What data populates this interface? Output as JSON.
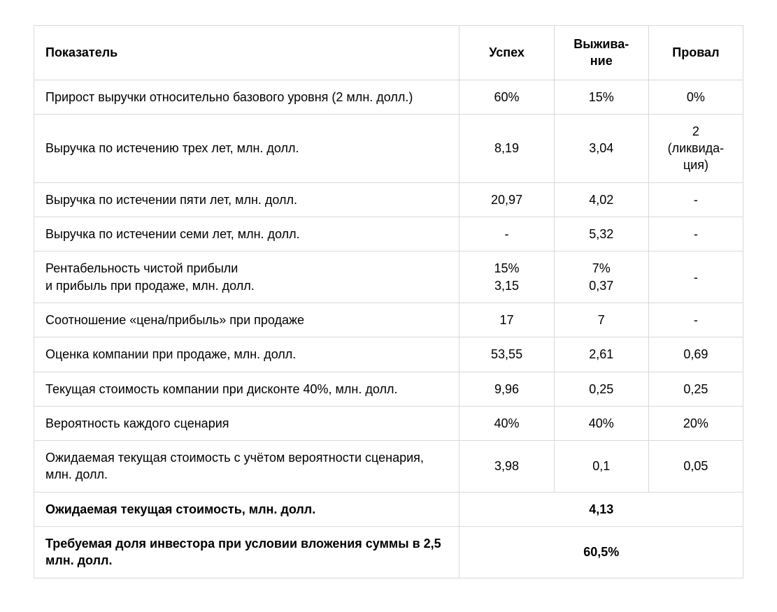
{
  "table": {
    "headers": {
      "indicator": "Показатель",
      "success": "Успех",
      "survival": "Выжива-\nние",
      "failure": "Провал"
    },
    "rows": [
      {
        "label": "Прирост выручки относительно базового уровня (2 млн. долл.)",
        "success": "60%",
        "survival": "15%",
        "failure": "0%"
      },
      {
        "label": "Выручка по истечению трех лет, млн. долл.",
        "success": "8,19",
        "survival": "3,04",
        "failure": "2\n(ликвида-\nция)"
      },
      {
        "label": "Выручка по истечении пяти лет, млн. долл.",
        "success": "20,97",
        "survival": "4,02",
        "failure": "-"
      },
      {
        "label": "Выручка по истечении семи лет, млн. долл.",
        "success": "-",
        "survival": "5,32",
        "failure": "-"
      },
      {
        "label": "Рентабельность чистой прибыли\nи прибыль при продаже, млн. долл.",
        "success": "15%\n3,15",
        "survival": "7%\n0,37",
        "failure": "-"
      },
      {
        "label": "Соотношение «цена/прибыль» при продаже",
        "success": "17",
        "survival": "7",
        "failure": "-"
      },
      {
        "label": "Оценка компании при продаже, млн. долл.",
        "success": "53,55",
        "survival": "2,61",
        "failure": "0,69"
      },
      {
        "label": "Текущая стоимость компании при дисконте 40%, млн. долл.",
        "success": "9,96",
        "survival": "0,25",
        "failure": "0,25"
      },
      {
        "label": "Вероятность каждого сценария",
        "success": "40%",
        "survival": "40%",
        "failure": "20%"
      },
      {
        "label": "Ожидаемая текущая стоимость с учётом вероятности сценария, млн. долл.",
        "success": "3,98",
        "survival": "0,1",
        "failure": "0,05"
      }
    ],
    "summary": [
      {
        "label": "Ожидаемая текущая стоимость, млн. долл.",
        "value": "4,13"
      },
      {
        "label": "Требуемая доля инвестора при условии вложения суммы в 2,5 млн. долл.",
        "value": "60,5%"
      }
    ]
  }
}
